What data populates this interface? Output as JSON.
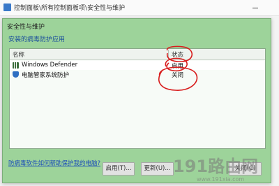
{
  "background_window": {
    "address": "控制面板\\所有控制面板项\\安全性与维护"
  },
  "dialog": {
    "title": "安全性与维护",
    "subtitle": "安装的病毒防护应用",
    "columns": {
      "name": "名称",
      "status": "状态"
    },
    "rows": [
      {
        "name": "Windows Defender",
        "status": "启用",
        "icon": "defender-icon"
      },
      {
        "name": "电脑管家系统防护",
        "status": "关闭",
        "icon": "shield-icon"
      }
    ],
    "help_link": "防病毒软件如何帮助保护我的电脑?",
    "buttons": {
      "enable": "启用(T)...",
      "update": "更新(U)...",
      "close": "关闭(C)"
    }
  },
  "watermark": {
    "text": "191路由网",
    "url": "www.191xia.com"
  },
  "colors": {
    "dialog_background": "#9dd39a",
    "annotation_red": "#d81e1e",
    "link_blue": "#1d4fb8"
  }
}
